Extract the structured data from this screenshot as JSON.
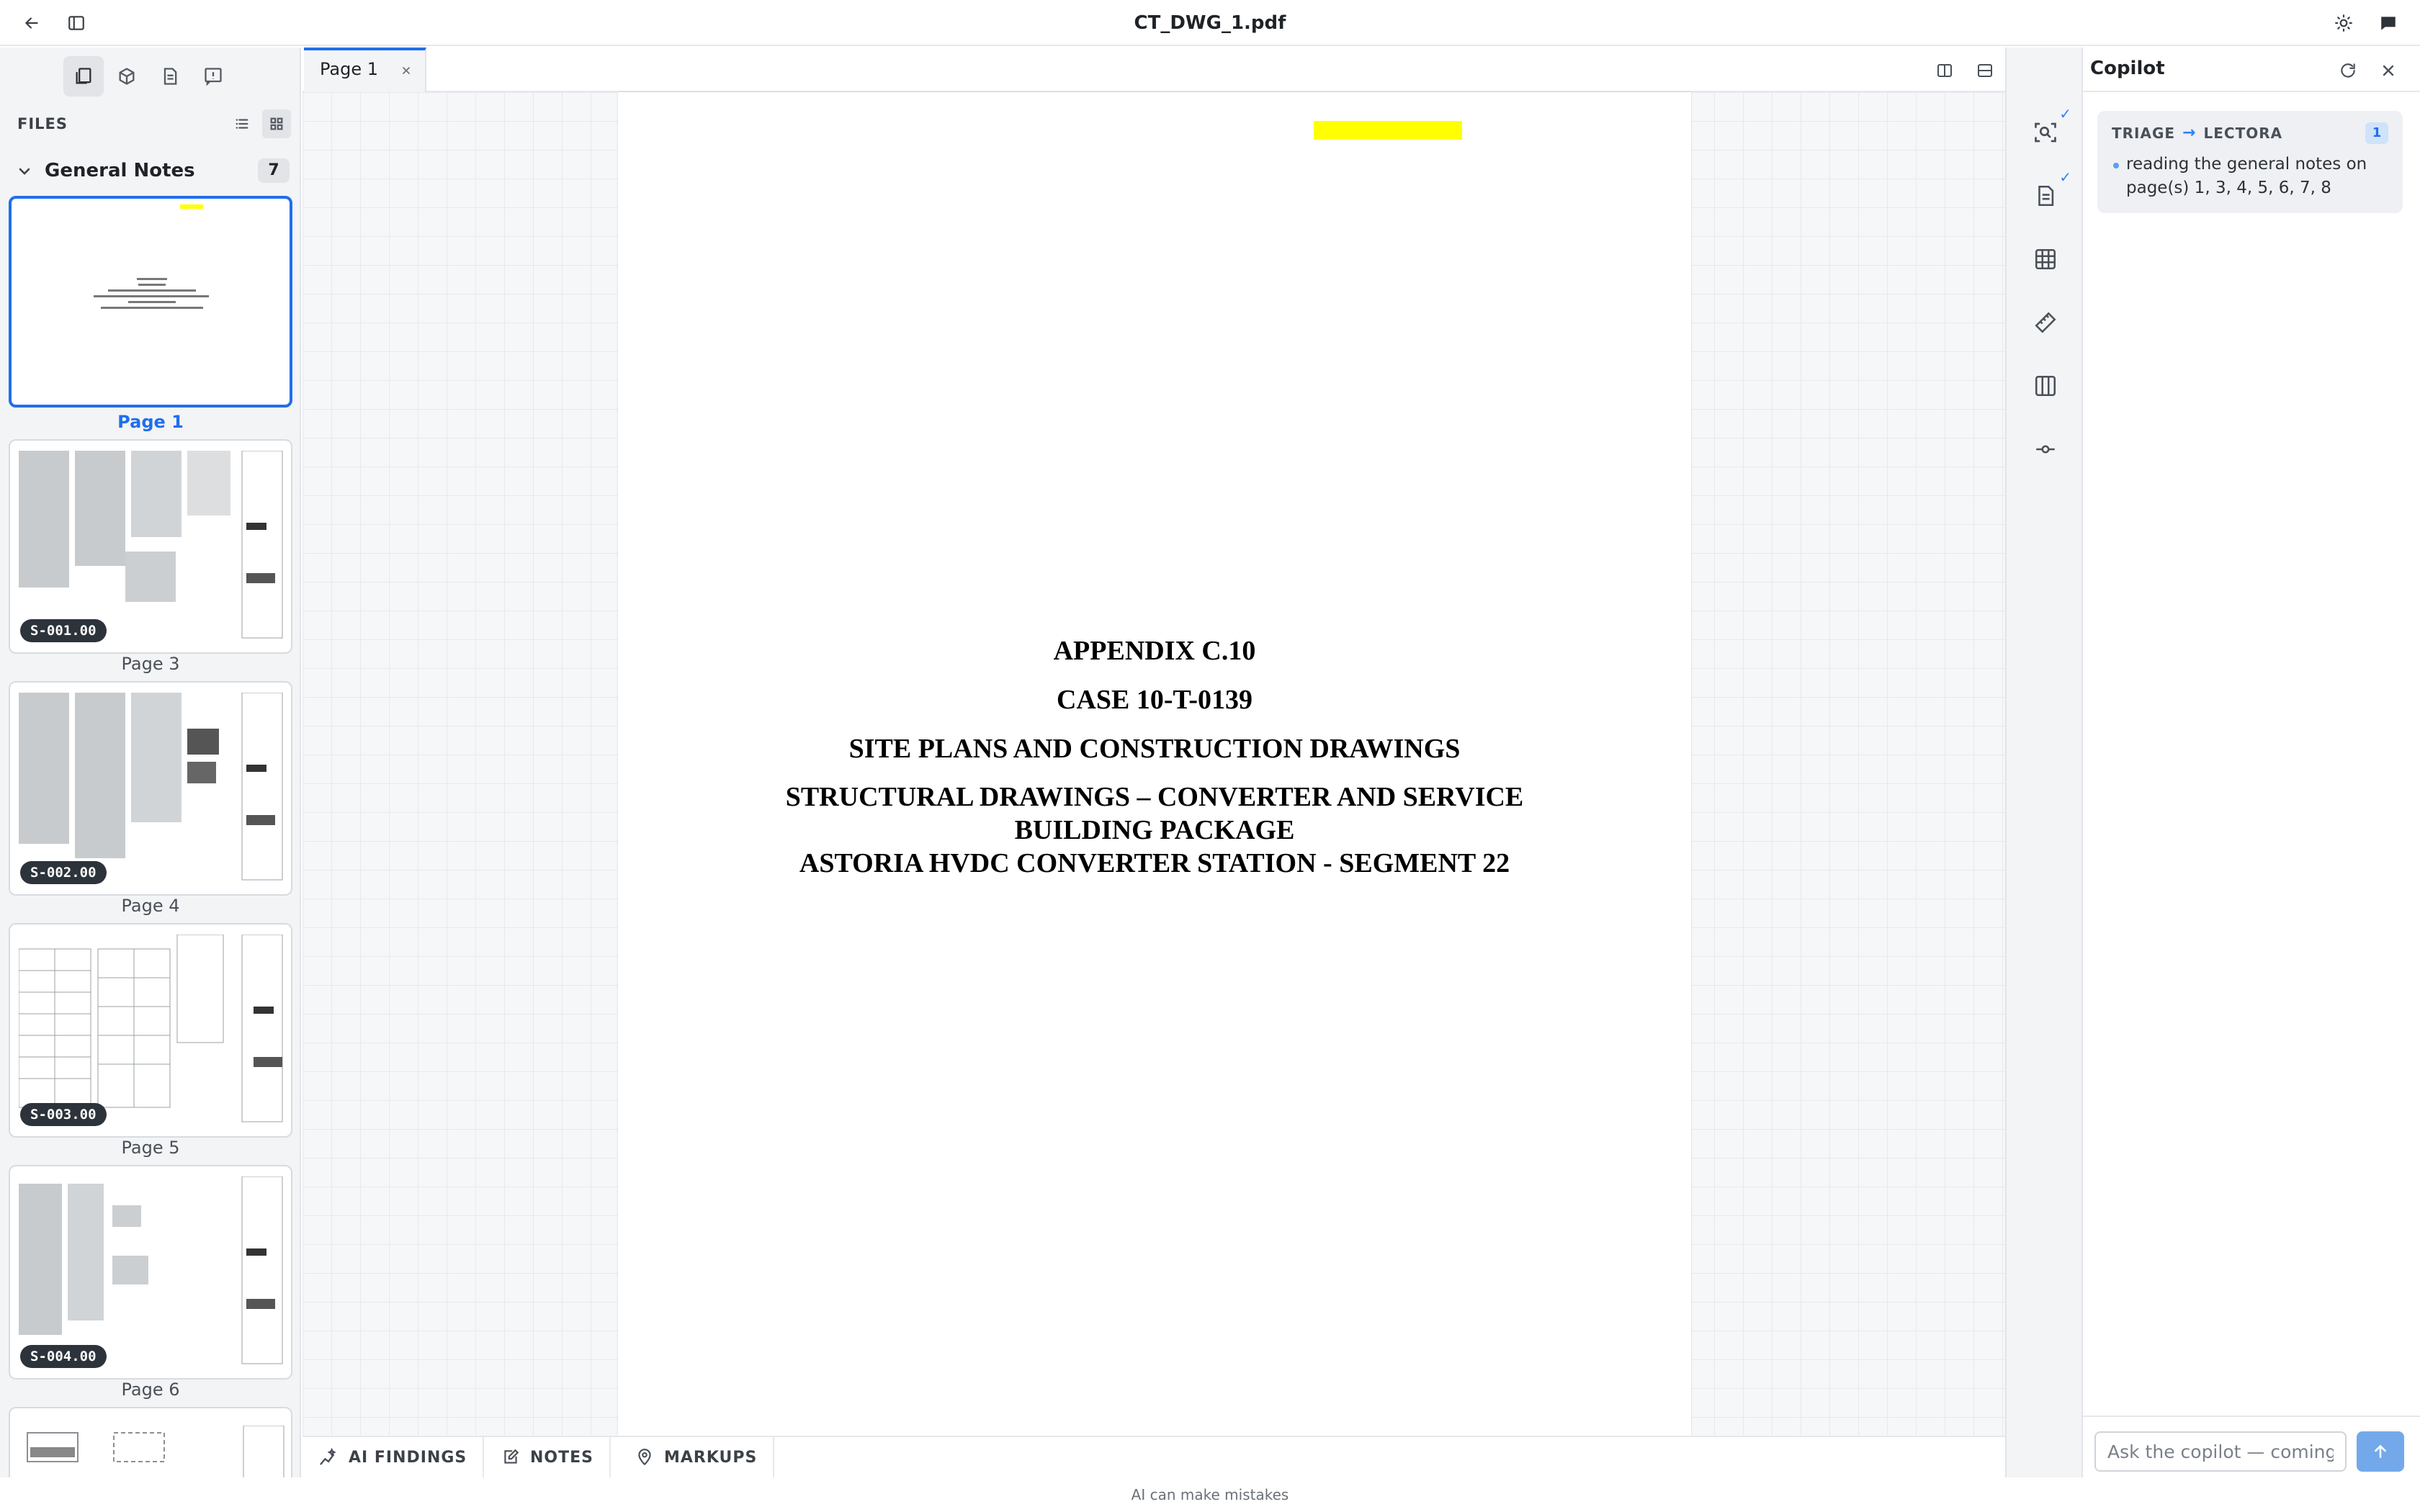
{
  "window": {
    "title": "CT_DWG_1.pdf"
  },
  "sidebar": {
    "files_label": "FILES",
    "section": {
      "title": "General Notes",
      "count": "7"
    },
    "pages": [
      {
        "label": "Page 1",
        "badge": ""
      },
      {
        "label": "Page 3",
        "badge": "S-001.00"
      },
      {
        "label": "Page 4",
        "badge": "S-002.00"
      },
      {
        "label": "Page 5",
        "badge": "S-003.00"
      },
      {
        "label": "Page 6",
        "badge": "S-004.00"
      }
    ]
  },
  "document": {
    "tab_label": "Page 1",
    "cover_lines": [
      "APPENDIX C.10",
      "CASE 10-T-0139",
      "SITE PLANS AND CONSTRUCTION DRAWINGS",
      "STRUCTURAL DRAWINGS – CONVERTER AND SERVICE",
      "BUILDING PACKAGE",
      "ASTORIA HVDC CONVERTER STATION - SEGMENT 22"
    ]
  },
  "bottom_tabs": {
    "ai_findings": "AI FINDINGS",
    "notes": "NOTES",
    "markups": "MARKUPS"
  },
  "copilot": {
    "title": "Copilot",
    "card": {
      "from": "TRIAGE",
      "to": "LECTORA",
      "count": "1",
      "message": "reading the general notes on page(s) 1, 3, 4, 5, 6, 7, 8"
    },
    "input_placeholder": "Ask the copilot — coming soon"
  },
  "footer": {
    "disclaimer": "AI can make mistakes"
  },
  "colors": {
    "accent": "#1f6feb",
    "highlight": "#ffff00",
    "send_button": "#73a9eb"
  }
}
